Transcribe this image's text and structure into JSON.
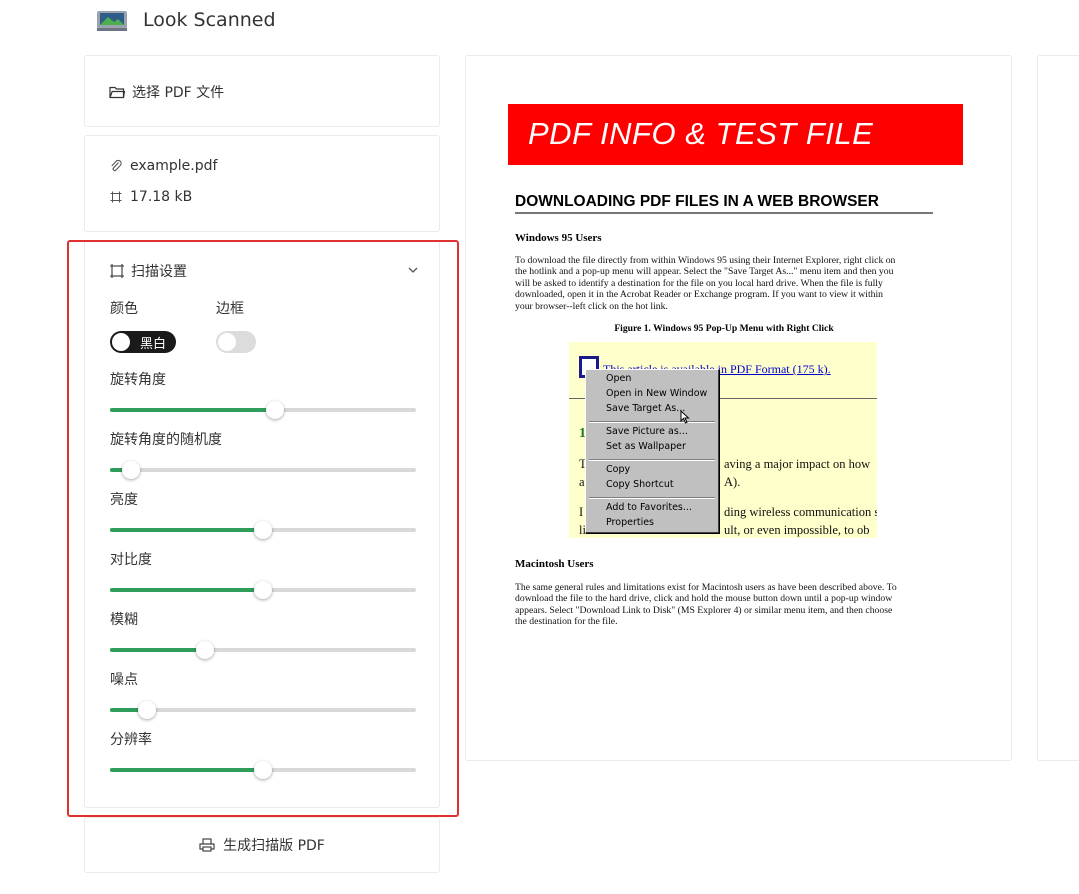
{
  "app": {
    "title": "Look Scanned",
    "logo_icon": "scanner-icon"
  },
  "select_file": {
    "label": "选择 PDF 文件",
    "icon": "folder-icon"
  },
  "file_info": {
    "name": "example.pdf",
    "size": "17.18 kB"
  },
  "settings": {
    "title": "扫描设置",
    "color_label": "颜色",
    "border_label": "边框",
    "color_toggle": {
      "text": "黑白",
      "on": true
    },
    "border_toggle": {
      "on": false
    },
    "sliders": [
      {
        "label": "旋转角度",
        "fraction": 0.54
      },
      {
        "label": "旋转角度的随机度",
        "fraction": 0.07
      },
      {
        "label": "亮度",
        "fraction": 0.5
      },
      {
        "label": "对比度",
        "fraction": 0.5
      },
      {
        "label": "模糊",
        "fraction": 0.31
      },
      {
        "label": "噪点",
        "fraction": 0.12
      },
      {
        "label": "分辨率",
        "fraction": 0.5
      }
    ],
    "accent_color": "#2e9e5a"
  },
  "generate": {
    "label": "生成扫描版 PDF",
    "icon": "printer-icon"
  },
  "preview": {
    "banner": "PDF INFO & TEST FILE",
    "heading": "DOWNLOADING PDF FILES IN A WEB BROWSER",
    "section1_title": "Windows 95 Users",
    "section1_lines": [
      "To download the file directly from within Windows 95 using their Internet Explorer, right click on",
      "the hotlink and a pop-up menu will appear. Select the \"Save Target As...\" menu item and then you",
      "will be asked to identify a destination for the file on you local hard drive. When the file is fully",
      "downloaded, open it in the Acrobat Reader or Exchange program. If you want to view it within",
      "your browser--left click on the hot link."
    ],
    "figure_caption": "Figure 1. Windows 95 Pop-Up Menu with Right Click",
    "figure": {
      "link": "This article is available in PDF Format (175 k).",
      "num": "1",
      "frag1a": "T",
      "frag1b": "aving a major impact on how",
      "frag2a": "a",
      "frag2b": "A).",
      "frag3a": "I",
      "frag3b": "ding wireless communication s",
      "frag4a": "li",
      "frag4b": "ult, or even impossible, to ob"
    },
    "context_menu": [
      "Open",
      "Open in New Window",
      "Save Target As...",
      "Save Picture as...",
      "Set as Wallpaper",
      "Copy",
      "Copy Shortcut",
      "Add to Favorites...",
      "Properties"
    ],
    "section2_title": "Macintosh Users",
    "section2_lines": [
      "The same general rules and limitations exist for Macintosh users as have been described above. To",
      "download the file to the hard drive, click and hold the mouse button down until a pop-up window",
      "appears. Select \"Download Link to Disk\" (MS Explorer 4) or similar menu item, and then choose",
      "the destination for the file."
    ],
    "banner_color": "#ff0000"
  }
}
